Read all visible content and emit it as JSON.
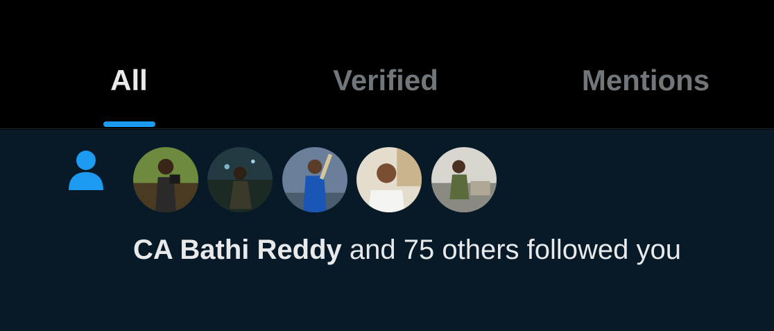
{
  "tabs": [
    {
      "label": "All",
      "active": true
    },
    {
      "label": "Verified",
      "active": false
    },
    {
      "label": "Mentions",
      "active": false
    }
  ],
  "notification": {
    "icon": "person-icon",
    "user_name": "CA Bathi Reddy",
    "message_rest": " and 75 others followed you",
    "avatar_count": 5
  },
  "colors": {
    "background": "#000000",
    "notification_bg": "#081a27",
    "accent": "#1d9bf0",
    "text_primary": "#e7e9ea",
    "text_secondary": "#71767b"
  }
}
